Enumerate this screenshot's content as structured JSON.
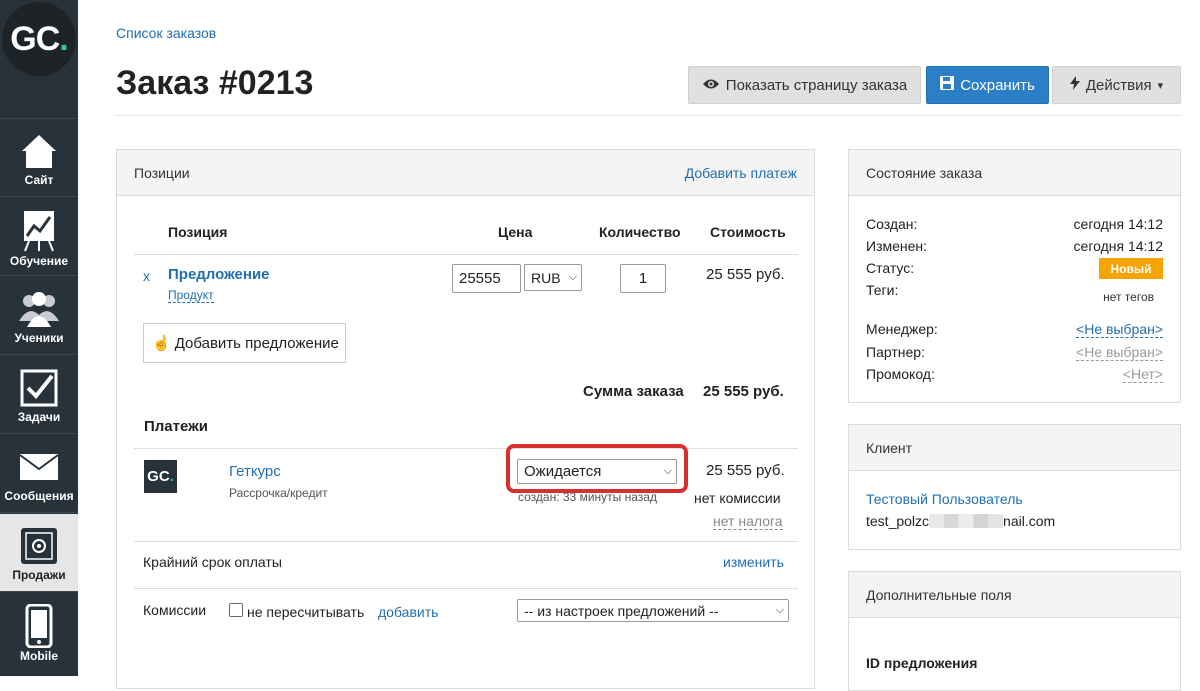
{
  "sidebar": {
    "logo_text": "GC",
    "logo_dot": ".",
    "items": [
      {
        "label": "Сайт",
        "icon": "house-icon"
      },
      {
        "label": "Обучение",
        "icon": "chart-board-icon"
      },
      {
        "label": "Ученики",
        "icon": "people-icon"
      },
      {
        "label": "Задачи",
        "icon": "checkbox-icon"
      },
      {
        "label": "Сообщения",
        "icon": "envelope-icon"
      },
      {
        "label": "Продажи",
        "icon": "safe-icon"
      },
      {
        "label": "Mobile",
        "icon": "phone-icon"
      }
    ]
  },
  "breadcrumb": "Список заказов",
  "page_title": "Заказ #0213",
  "header_buttons": {
    "show_page": "Показать страницу заказа",
    "save": "Сохранить",
    "actions": "Действия"
  },
  "positions_panel": {
    "title": "Позиции",
    "add_payment": "Добавить платеж",
    "columns": {
      "position": "Позиция",
      "price": "Цена",
      "quantity": "Количество",
      "cost": "Стоимость"
    },
    "row": {
      "remove": "x",
      "name": "Предложение",
      "type": "Продукт",
      "price": "25555",
      "currency": "RUB",
      "quantity": "1",
      "cost": "25 555 руб."
    },
    "add_offer": "Добавить предложение",
    "sum_label": "Сумма заказа",
    "sum_value": "25 555 руб.",
    "payments_title": "Платежи",
    "payment": {
      "logo_text": "GC",
      "logo_dot": ".",
      "name": "Геткурс",
      "method": "Рассрочка/кредит",
      "status": "Ожидается",
      "created": "создан: 33 минуты назад",
      "amount": "25 555 руб.",
      "commission": "нет комиссии",
      "tax": "нет налога"
    },
    "deadline_label": "Крайний срок оплаты",
    "deadline_change": "изменить",
    "commissions_label": "Комиссии",
    "no_recalc": "не пересчитывать",
    "add_commission": "добавить",
    "commission_select": "-- из настроек предложений --"
  },
  "state_panel": {
    "title": "Состояние заказа",
    "created_label": "Создан:",
    "created_value": "сегодня 14:12",
    "changed_label": "Изменен:",
    "changed_value": "сегодня 14:12",
    "status_label": "Статус:",
    "status_value": "Новый",
    "tags_label": "Теги:",
    "tags_value": "нет тегов",
    "manager_label": "Менеджер:",
    "manager_value": "<Не выбран>",
    "partner_label": "Партнер:",
    "partner_value": "<Не выбран>",
    "promo_label": "Промокод:",
    "promo_value": "<Нет>"
  },
  "client_panel": {
    "title": "Клиент",
    "name": "Тестовый Пользователь",
    "email_prefix": "test_polzc",
    "email_suffix": "nail.com"
  },
  "extra_panel": {
    "title": "Дополнительные поля",
    "offer_id_label": "ID предложения"
  },
  "colors": {
    "sidebar": "#27323a",
    "accent": "#1f6fb2",
    "save_button": "#2a7fc7",
    "status_badge": "#f5a400",
    "highlight": "#d9302f",
    "logo_dot": "#2fc4b2"
  }
}
